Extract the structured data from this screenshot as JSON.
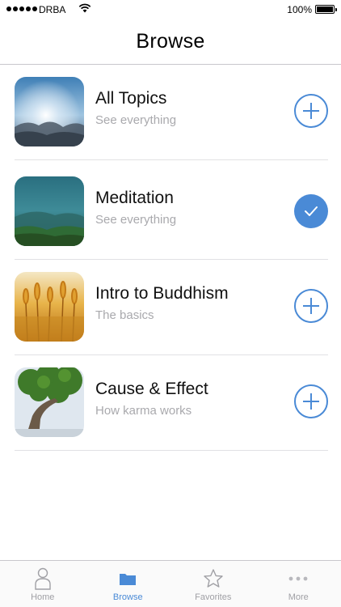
{
  "status_bar": {
    "carrier": "DRBA",
    "battery_percent": "100%"
  },
  "nav": {
    "title": "Browse"
  },
  "topics": [
    {
      "title": "All Topics",
      "subtitle": "See everything",
      "action": "add",
      "thumbnail": "sky-rays"
    },
    {
      "title": "Meditation",
      "subtitle": "See everything",
      "action": "checked",
      "thumbnail": "teal-mountain"
    },
    {
      "title": "Intro to Buddhism",
      "subtitle": "The basics",
      "action": "add",
      "thumbnail": "wheat-field"
    },
    {
      "title": "Cause & Effect",
      "subtitle": "How karma works",
      "action": "add",
      "thumbnail": "tree"
    }
  ],
  "tabs": [
    {
      "label": "Home",
      "icon": "person-icon",
      "active": false
    },
    {
      "label": "Browse",
      "icon": "folder-icon",
      "active": true
    },
    {
      "label": "Favorites",
      "icon": "star-icon",
      "active": false
    },
    {
      "label": "More",
      "icon": "more-dots-icon",
      "active": false
    }
  ],
  "colors": {
    "accent": "#4a8ad6",
    "subtitle": "#a9a9ad",
    "tab_inactive": "#a0a0a5"
  }
}
